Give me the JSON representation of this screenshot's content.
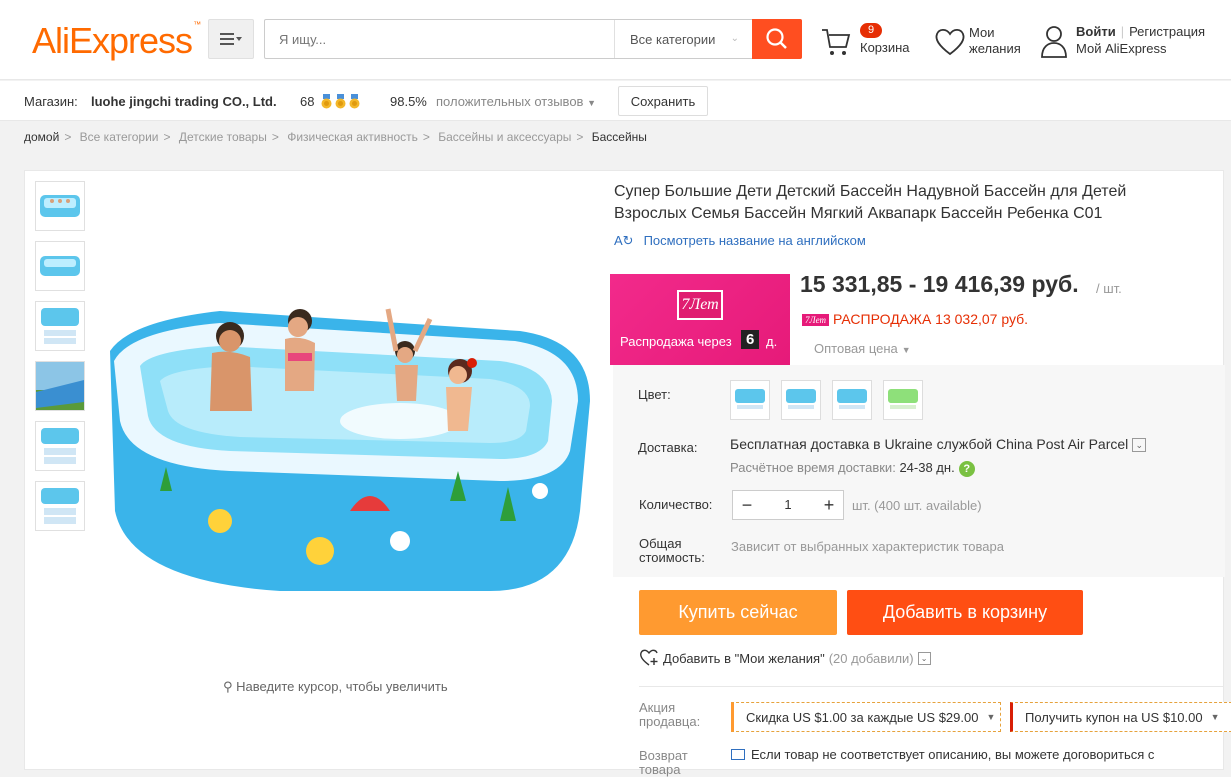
{
  "header": {
    "logo": "AliExpress",
    "search_placeholder": "Я ищу...",
    "category_label": "Все категории",
    "cart_count": "9",
    "cart_label": "Корзина",
    "wish_label_1": "Мои",
    "wish_label_2": "желания",
    "login": "Войти",
    "register": "Регистрация",
    "my_account": "Мой AliExpress"
  },
  "store": {
    "label": "Магазин:",
    "name": "luohe jingchi trading CO., Ltd.",
    "score": "68",
    "positive_pct": "98.5%",
    "feedback_label": "положительных отзывов",
    "save_label": "Сохранить"
  },
  "breadcrumb": [
    "домой",
    "Все категории",
    "Детские товары",
    "Физическая активность",
    "Бассейны и аксессуары",
    "Бассейны"
  ],
  "product": {
    "title": "Супер Большие Дети Детский Бассейн Надувной Бассейн для Детей Взрослых Семья Бассейн Мягкий Аквапарк Бассейн Ребенка C01",
    "translate_link": "Посмотреть название на английском",
    "zoom_hint": "Наведите курсор, чтобы увеличить"
  },
  "promo": {
    "logo_text": "7Лет",
    "text": "Распродажа через",
    "days": "6",
    "days_unit": "д."
  },
  "price": {
    "range": "15 331,85 - 19 416,39 руб.",
    "unit": "/ шт.",
    "sale_badge": "7Лет",
    "sale_text": "РАСПРОДАЖА 13 032,07 руб.",
    "wholesale": "Оптовая цена"
  },
  "props": {
    "color_label": "Цвет:",
    "shipping_label": "Доставка:",
    "shipping_text": "Бесплатная доставка в Ukraine службой China Post Air Parcel",
    "shipping_est_label": "Расчётное время доставки:",
    "shipping_est_days": "24-38 дн.",
    "qty_label": "Количество:",
    "qty_value": "1",
    "qty_avail": "шт. (400 шт. available)",
    "total_label_1": "Общая",
    "total_label_2": "стоимость:",
    "total_note": "Зависит от выбранных характеристик товара"
  },
  "actions": {
    "buy_now": "Купить сейчас",
    "add_to_cart": "Добавить в корзину",
    "wish_add": "Добавить в \"Мои желания\"",
    "wish_count": "(20 добавили)"
  },
  "seller_promo": {
    "label_1": "Акция",
    "label_2": "продавца:",
    "coupon1": "Скидка US $1.00 за каждые US $29.00",
    "coupon2": "Получить купон на US $10.00"
  },
  "returns": {
    "label_1": "Возврат",
    "label_2": "товара",
    "text": "Если товар не соответствует описанию, вы можете договориться с"
  },
  "colors": {
    "brand": "#ff6a00",
    "search_btn": "#ff4e20",
    "buy_now": "#ff9a30",
    "add_to_cart": "#ff4e13",
    "sale_red": "#e62e04",
    "promo_pink": "#e61a79"
  }
}
